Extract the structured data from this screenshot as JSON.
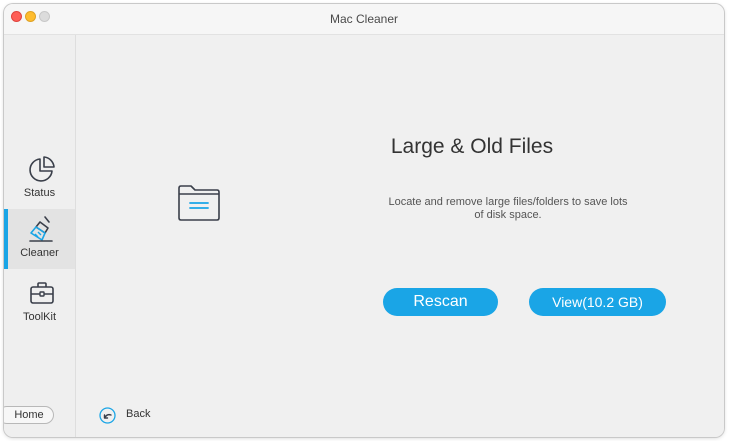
{
  "window": {
    "title": "Mac Cleaner"
  },
  "sidebar": {
    "items": [
      {
        "label": "Status",
        "icon": "pie-chart-icon",
        "active": false
      },
      {
        "label": "Cleaner",
        "icon": "broom-icon",
        "active": true
      },
      {
        "label": "ToolKit",
        "icon": "toolbox-icon",
        "active": false
      }
    ],
    "home_label": "Home"
  },
  "main": {
    "icon": "folder-icon",
    "title": "Large & Old Files",
    "description": "Locate and remove large files/folders to save lots of disk space.",
    "rescan_label": "Rescan",
    "view_label": "View(10.2 GB)",
    "back_label": "Back"
  },
  "colors": {
    "accent": "#1aa5e6",
    "icon_stroke": "#3a3f4a"
  }
}
